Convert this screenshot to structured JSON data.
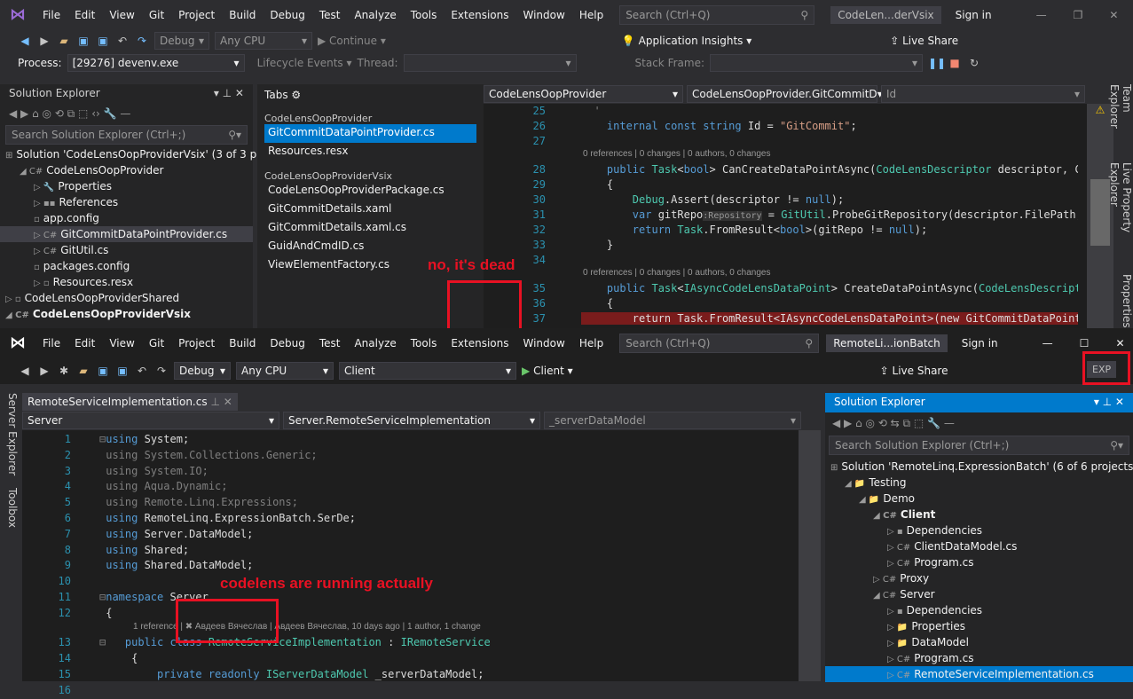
{
  "top": {
    "menu": [
      "File",
      "Edit",
      "View",
      "Git",
      "Project",
      "Build",
      "Debug",
      "Test",
      "Analyze",
      "Tools",
      "Extensions",
      "Window",
      "Help"
    ],
    "search_placeholder": "Search (Ctrl+Q)",
    "window_title": "CodeLen...derVsix",
    "sign_in": "Sign in",
    "toolbar": {
      "config": "Debug",
      "platform": "Any CPU",
      "continue": "Continue",
      "app_insights": "Application Insights",
      "live_share": "Live Share"
    },
    "toolbar2": {
      "process_label": "Process:",
      "process": "[29276] devenv.exe",
      "lifecycle": "Lifecycle Events",
      "thread": "Thread:",
      "stack_frame": "Stack Frame:"
    },
    "solution_explorer": {
      "title": "Solution Explorer",
      "search": "Search Solution Explorer (Ctrl+;)",
      "items": [
        {
          "label": "Solution 'CodeLensOopProviderVsix' (3 of 3 pr",
          "indent": 0,
          "icon": "⊞"
        },
        {
          "label": "CodeLensOopProvider",
          "indent": 1,
          "icon": "◢ C#"
        },
        {
          "label": "Properties",
          "indent": 2,
          "icon": "▷ 🔧"
        },
        {
          "label": "References",
          "indent": 2,
          "icon": "▷ ▪▪"
        },
        {
          "label": "app.config",
          "indent": 2,
          "icon": "  ▫"
        },
        {
          "label": "GitCommitDataPointProvider.cs",
          "indent": 2,
          "icon": "▷ C#",
          "sel": true
        },
        {
          "label": "GitUtil.cs",
          "indent": 2,
          "icon": "▷ C#"
        },
        {
          "label": "packages.config",
          "indent": 2,
          "icon": "  ▫"
        },
        {
          "label": "Resources.resx",
          "indent": 2,
          "icon": "▷ ▫"
        },
        {
          "label": "CodeLensOopProviderShared",
          "indent": 0,
          "icon": "▷ ▫"
        },
        {
          "label": "CodeLensOopProviderVsix",
          "indent": 0,
          "icon": "◢ C#",
          "bold": true
        }
      ]
    },
    "tabs_panel": {
      "title": "Tabs",
      "groups": [
        {
          "name": "CodeLensOopProvider",
          "files": [
            "GitCommitDataPointProvider.cs",
            "Resources.resx"
          ]
        },
        {
          "name": "CodeLensOopProviderVsix",
          "files": [
            "CodeLensOopProviderPackage.cs",
            "GitCommitDetails.xaml",
            "GitCommitDetails.xaml.cs",
            "GuidAndCmdID.cs",
            "ViewElementFactory.cs"
          ]
        }
      ]
    },
    "nav": {
      "project": "CodeLensOopProvider",
      "type": "CodeLensOopProvider.GitCommitD",
      "member": "Id"
    },
    "code": [
      {
        "n": "25",
        "t": [
          [
            "  '",
            "dim"
          ]
        ]
      },
      {
        "n": "26",
        "t": [
          [
            "    internal const string ",
            "kw"
          ],
          [
            "Id = ",
            "tx"
          ],
          [
            "\"GitCommit\"",
            "st"
          ],
          [
            ";",
            "tx"
          ]
        ]
      },
      {
        "n": "27",
        "t": []
      },
      {
        "lens": "0 references | 0 changes | 0 authors, 0 changes"
      },
      {
        "n": "28",
        "t": [
          [
            "    public ",
            "kw"
          ],
          [
            "Task",
            "ty"
          ],
          [
            "<",
            "tx"
          ],
          [
            "bool",
            "kw"
          ],
          [
            "> CanCreateDataPointAsync(",
            "tx"
          ],
          [
            "CodeLensDescriptor",
            "ty"
          ],
          [
            " descriptor, CodeL",
            "tx"
          ]
        ]
      },
      {
        "n": "29",
        "t": [
          [
            "    {",
            "tx"
          ]
        ]
      },
      {
        "n": "30",
        "t": [
          [
            "        ",
            "tx"
          ],
          [
            "Debug",
            "ty"
          ],
          [
            ".Assert(descriptor != ",
            "tx"
          ],
          [
            "null",
            "kw"
          ],
          [
            ");",
            "tx"
          ]
        ]
      },
      {
        "n": "31",
        "t": [
          [
            "        var ",
            "kw"
          ],
          [
            "gitRepo",
            "tx"
          ],
          [
            ":Repository",
            "hint"
          ],
          [
            " = ",
            "tx"
          ],
          [
            "GitUtil",
            "ty"
          ],
          [
            ".ProbeGitRepository(descriptor.FilePath, out",
            "tx"
          ]
        ]
      },
      {
        "n": "32",
        "t": [
          [
            "        return ",
            "kw"
          ],
          [
            "Task",
            "ty"
          ],
          [
            ".FromResult<",
            "tx"
          ],
          [
            "bool",
            "kw"
          ],
          [
            ">(gitRepo != ",
            "tx"
          ],
          [
            "null",
            "kw"
          ],
          [
            ");",
            "tx"
          ]
        ]
      },
      {
        "n": "33",
        "t": [
          [
            "    }",
            "tx"
          ]
        ]
      },
      {
        "n": "34",
        "t": []
      },
      {
        "lens": "0 references | 0 changes | 0 authors, 0 changes"
      },
      {
        "n": "35",
        "t": [
          [
            "    public ",
            "kw"
          ],
          [
            "Task",
            "ty"
          ],
          [
            "<",
            "tx"
          ],
          [
            "IAsyncCodeLensDataPoint",
            "ty"
          ],
          [
            "> CreateDataPointAsync(",
            "tx"
          ],
          [
            "CodeLensDescriptor",
            "ty"
          ],
          [
            " c",
            "tx"
          ]
        ]
      },
      {
        "n": "36",
        "t": [
          [
            "    {",
            "tx"
          ]
        ]
      },
      {
        "n": "37",
        "t": [
          [
            "        return Task.FromResult<IAsyncCodeLensDataPoint>(new GitCommitDataPoint(des",
            "tx"
          ]
        ],
        "bp": true
      }
    ],
    "side_tabs": [
      "Team Explorer",
      "Live Property Explorer",
      "Properties"
    ],
    "annotation": "no, it's dead"
  },
  "bottom": {
    "menu": [
      "File",
      "Edit",
      "View",
      "Git",
      "Project",
      "Build",
      "Debug",
      "Test",
      "Analyze",
      "Tools",
      "Extensions",
      "Window",
      "Help"
    ],
    "search_placeholder": "Search (Ctrl+Q)",
    "window_title": "RemoteLi...ionBatch",
    "sign_in": "Sign in",
    "toolbar": {
      "config": "Debug",
      "platform": "Any CPU",
      "startup": "Client",
      "run": "Client",
      "live_share": "Live Share",
      "exp": "EXP"
    },
    "left_tabs": [
      "Server Explorer",
      "Toolbox"
    ],
    "doc_tab": "RemoteServiceImplementation.cs",
    "nav": {
      "project": "Server",
      "type": "Server.RemoteServiceImplementation",
      "member": "_serverDataModel"
    },
    "code": [
      {
        "n": "1",
        "t": [
          [
            "⊟",
            "dim"
          ],
          [
            "using ",
            "kw"
          ],
          [
            "System;",
            "tx"
          ]
        ]
      },
      {
        "n": "2",
        "t": [
          [
            " using ",
            "dim"
          ],
          [
            "System.Collections.Generic;",
            "dim"
          ]
        ]
      },
      {
        "n": "3",
        "t": [
          [
            " using ",
            "dim"
          ],
          [
            "System.IO;",
            "dim"
          ]
        ]
      },
      {
        "n": "4",
        "t": [
          [
            " using ",
            "dim"
          ],
          [
            "Aqua.Dynamic;",
            "dim"
          ]
        ]
      },
      {
        "n": "5",
        "t": [
          [
            " using ",
            "dim"
          ],
          [
            "Remote.Linq.Expressions;",
            "dim"
          ]
        ]
      },
      {
        "n": "6",
        "t": [
          [
            " using ",
            "kw"
          ],
          [
            "RemoteLinq.ExpressionBatch.SerDe;",
            "tx"
          ]
        ]
      },
      {
        "n": "7",
        "t": [
          [
            " using ",
            "kw"
          ],
          [
            "Server.DataModel;",
            "tx"
          ]
        ]
      },
      {
        "n": "8",
        "t": [
          [
            " using ",
            "kw"
          ],
          [
            "Shared;",
            "tx"
          ]
        ]
      },
      {
        "n": "9",
        "t": [
          [
            " using ",
            "kw"
          ],
          [
            "Shared.DataModel;",
            "tx"
          ]
        ]
      },
      {
        "n": "10",
        "t": []
      },
      {
        "n": "11",
        "t": [
          [
            "⊟",
            "dim"
          ],
          [
            "namespace ",
            "kw"
          ],
          [
            "Server",
            "tx"
          ]
        ]
      },
      {
        "n": "12",
        "t": [
          [
            " {",
            "tx"
          ]
        ]
      },
      {
        "lens": "1 reference | ✖ Авдеев Вячеслав | Авдеев Вячеслав, 10 days ago | 1 author, 1 change"
      },
      {
        "n": "13",
        "t": [
          [
            "⊟   ",
            "dim"
          ],
          [
            "public class ",
            "kw"
          ],
          [
            "RemoteServiceImplementation",
            "ty"
          ],
          [
            " : ",
            "tx"
          ],
          [
            "IRemoteService",
            "ty"
          ]
        ]
      },
      {
        "n": "14",
        "t": [
          [
            "     {",
            "tx"
          ]
        ]
      },
      {
        "n": "15",
        "t": [
          [
            "         private readonly ",
            "kw"
          ],
          [
            "IServerDataModel",
            "ty"
          ],
          [
            " _serverDataModel;",
            "tx"
          ]
        ]
      },
      {
        "n": "16",
        "t": []
      }
    ],
    "annotation": "codelens are running actually",
    "solution_explorer": {
      "title": "Solution Explorer",
      "search": "Search Solution Explorer (Ctrl+;)",
      "items": [
        {
          "label": "Solution 'RemoteLinq.ExpressionBatch' (6 of 6 projects)",
          "indent": 0,
          "icon": "⊞"
        },
        {
          "label": "Testing",
          "indent": 1,
          "icon": "◢ 📁"
        },
        {
          "label": "Demo",
          "indent": 2,
          "icon": "◢ 📁"
        },
        {
          "label": "Client",
          "indent": 3,
          "icon": "◢ C#",
          "bold": true
        },
        {
          "label": "Dependencies",
          "indent": 4,
          "icon": "▷ ▪"
        },
        {
          "label": "ClientDataModel.cs",
          "indent": 4,
          "icon": "▷ C#"
        },
        {
          "label": "Program.cs",
          "indent": 4,
          "icon": "▷ C#"
        },
        {
          "label": "Proxy",
          "indent": 3,
          "icon": "▷ C#"
        },
        {
          "label": "Server",
          "indent": 3,
          "icon": "◢ C#"
        },
        {
          "label": "Dependencies",
          "indent": 4,
          "icon": "▷ ▪"
        },
        {
          "label": "Properties",
          "indent": 4,
          "icon": "▷ 📁"
        },
        {
          "label": "DataModel",
          "indent": 4,
          "icon": "▷ 📁"
        },
        {
          "label": "Program.cs",
          "indent": 4,
          "icon": "▷ C#"
        },
        {
          "label": "RemoteServiceImplementation.cs",
          "indent": 4,
          "icon": "▷ C#",
          "selb": true
        }
      ]
    }
  }
}
